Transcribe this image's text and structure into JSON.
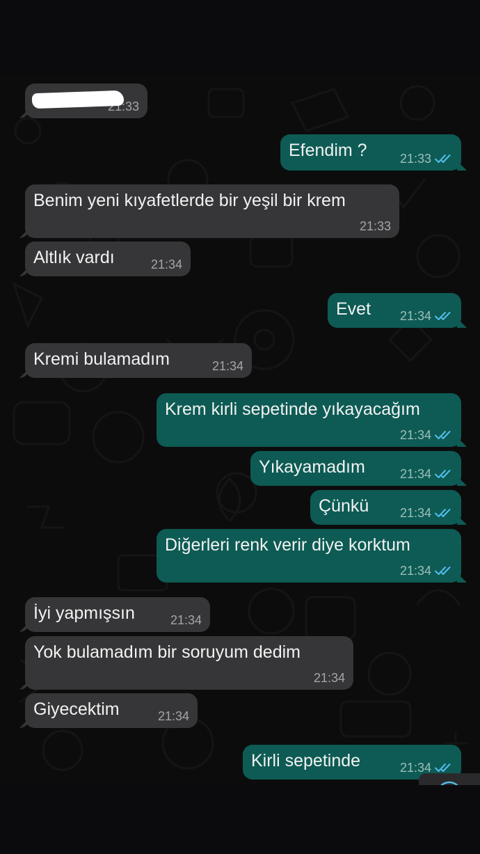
{
  "messages": [
    {
      "dir": "in",
      "text": "",
      "time": "21:33",
      "redacted": true
    },
    {
      "dir": "out",
      "text": "Efendim ?",
      "time": "21:33",
      "read": true
    },
    {
      "dir": "in",
      "text": "Benim yeni kıyafetlerde bir yeşil bir krem",
      "time": "21:33"
    },
    {
      "dir": "in",
      "text": "Altlık vardı",
      "time": "21:34"
    },
    {
      "dir": "out",
      "text": "Evet",
      "time": "21:34",
      "read": true
    },
    {
      "dir": "in",
      "text": "Kremi bulamadım",
      "time": "21:34"
    },
    {
      "dir": "out",
      "text": "Krem kirli sepetinde yıkayacağım",
      "time": "21:34",
      "read": true
    },
    {
      "dir": "out",
      "text": "Yıkayamadım",
      "time": "21:34",
      "read": true
    },
    {
      "dir": "out",
      "text": "Çünkü",
      "time": "21:34",
      "read": true
    },
    {
      "dir": "out",
      "text": "Diğerleri renk verir diye korktum",
      "time": "21:34",
      "read": true
    },
    {
      "dir": "in",
      "text": "İyi yapmışsın",
      "time": "21:34"
    },
    {
      "dir": "in",
      "text": "Yok bulamadım bir soruyum dedim",
      "time": "21:34"
    },
    {
      "dir": "in",
      "text": "Giyecektim",
      "time": "21:34"
    },
    {
      "dir": "out",
      "text": "Kirli sepetinde",
      "time": "21:34",
      "read": true
    }
  ],
  "scroll_button": {
    "icon": "chevron-down-circle-icon"
  },
  "colors": {
    "incoming_bubble": "#363638",
    "outgoing_bubble": "#0d5b54",
    "read_tick": "#53bdeb",
    "background": "#0c0c0c"
  }
}
